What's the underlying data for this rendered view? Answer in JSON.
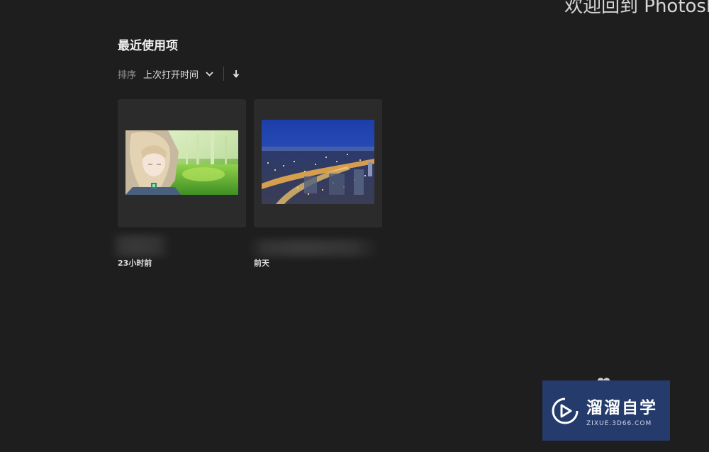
{
  "header": {
    "welcome_title": "欢迎回到 Photoshop"
  },
  "recent": {
    "title": "最近使用项",
    "sort": {
      "label": "排序",
      "selected": "上次打开时间",
      "direction_icon": "arrow-down-icon"
    },
    "files": [
      {
        "thumbnail": "anime-girl-in-forest",
        "name": "",
        "time": "23小时前"
      },
      {
        "thumbnail": "city-night-aerial",
        "name": "",
        "time": "前天"
      }
    ]
  },
  "watermark": {
    "name": "溜溜自学",
    "url": "ZIXUE.3D66.COM",
    "background": "#253b6b"
  },
  "colors": {
    "background": "#1e1e1e",
    "card": "#2b2b2b",
    "muted_text": "#9a9a9a"
  }
}
